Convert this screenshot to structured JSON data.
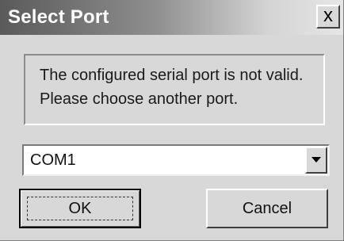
{
  "dialog": {
    "title": "Select Port",
    "close_glyph": "x",
    "message": [
      "The configured serial port is not valid.",
      "Please choose another port."
    ],
    "port_select": {
      "selected_value": "COM1"
    },
    "buttons": {
      "ok_label": "OK",
      "cancel_label": "Cancel"
    }
  }
}
